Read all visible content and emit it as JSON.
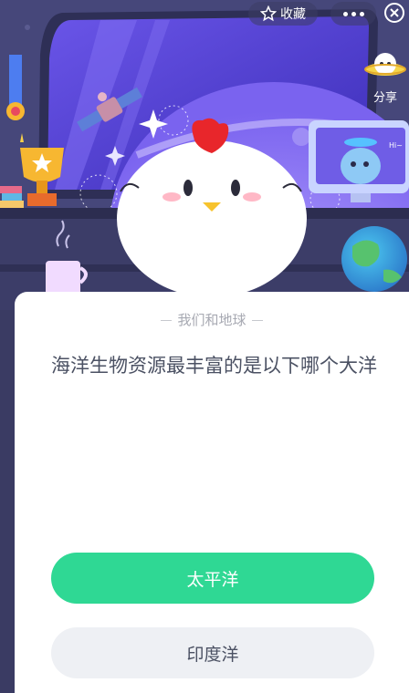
{
  "header": {
    "favorite_label": "收藏",
    "share_label": "分享",
    "icons": [
      "star-icon",
      "more-icon",
      "close-icon",
      "share-icon"
    ]
  },
  "quiz": {
    "category": "我们和地球",
    "question": "海洋生物资源最丰富的是以下哪个大洋",
    "options": [
      "太平洋",
      "印度洋"
    ]
  },
  "scene": {
    "monitor_text": "Hi~"
  },
  "colors": {
    "primary_option": "#2fd894",
    "secondary_option": "#eef0f4",
    "question_text": "#4b5163",
    "category_text": "#a7a9b2"
  }
}
